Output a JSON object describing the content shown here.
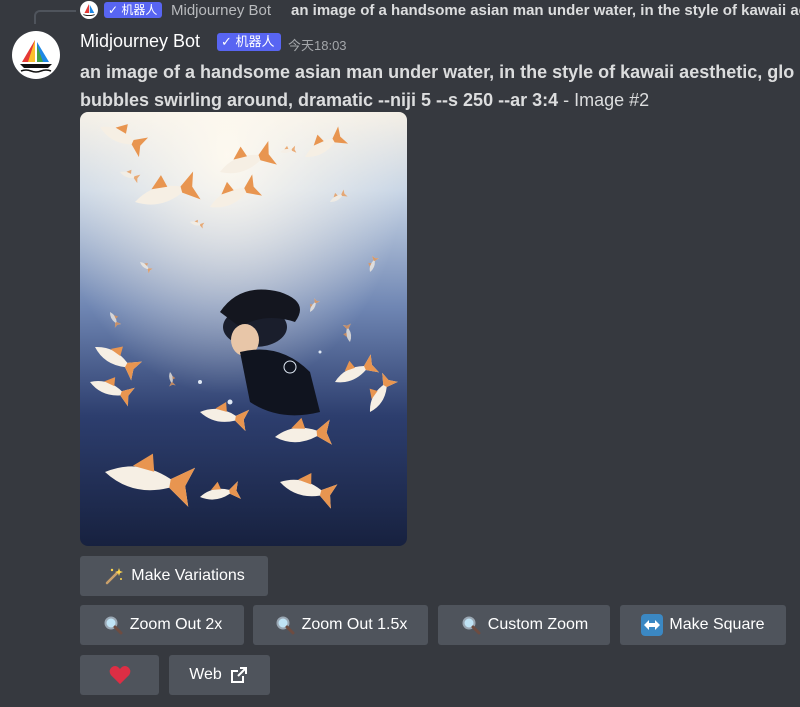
{
  "reply": {
    "badge": "✓ 机器人",
    "author": "Midjourney Bot",
    "text": "an image of a handsome asian man under water, in the style of kawaii aesthetic, glowing"
  },
  "message": {
    "author": "Midjourney Bot",
    "badge": "✓ 机器人",
    "timestamp": "今天18:03",
    "prompt_line1": "an image of a handsome asian man under water, in the style of kawaii aesthetic, glo",
    "prompt_line2": "bubbles swirling around, dramatic --niji 5 --s 250 --ar 3:4",
    "prompt_suffix": " - Image #2"
  },
  "buttons": {
    "make_variations": "Make Variations",
    "zoom_out_2x": "Zoom Out 2x",
    "zoom_out_1_5x": "Zoom Out 1.5x",
    "custom_zoom": "Custom Zoom",
    "make_square": "Make Square",
    "web": "Web"
  },
  "colors": {
    "background": "#36393f",
    "button": "#4f545c",
    "bot_badge": "#5865f2",
    "heart": "#dd2e44"
  }
}
